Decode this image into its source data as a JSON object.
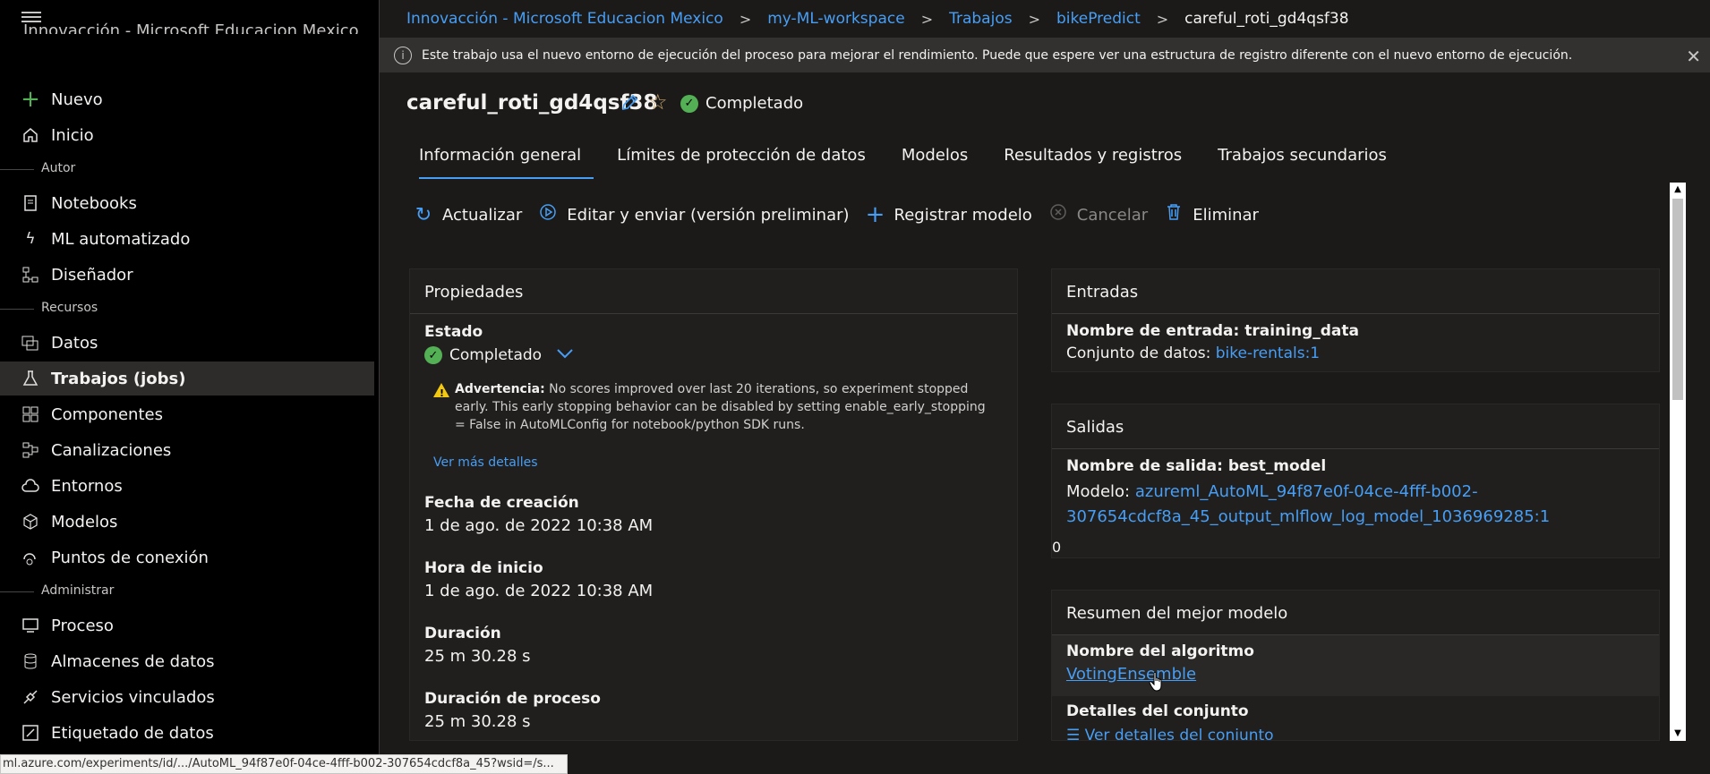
{
  "sidebar": {
    "workspace_name": "Innovacción - Microsoft Educacion Mexico",
    "new_label": "Nuevo",
    "home_label": "Inicio",
    "sections": {
      "author": "Autor",
      "assets": "Recursos",
      "manage": "Administrar"
    },
    "items": {
      "notebooks": "Notebooks",
      "automl": "ML automatizado",
      "designer": "Diseñador",
      "data": "Datos",
      "jobs": "Trabajos (jobs)",
      "components": "Componentes",
      "pipelines": "Canalizaciones",
      "environments": "Entornos",
      "models": "Modelos",
      "endpoints": "Puntos de conexión",
      "compute": "Proceso",
      "datastores": "Almacenes de datos",
      "linked": "Servicios vinculados",
      "labeling": "Etiquetado de datos"
    }
  },
  "breadcrumb": {
    "org": "Innovacción - Microsoft Educacion Mexico",
    "workspace": "my-ML-workspace",
    "jobs": "Trabajos",
    "experiment": "bikePredict",
    "current": "careful_roti_gd4qsf38"
  },
  "banner": {
    "text": "Este trabajo usa el nuevo entorno de ejecución del proceso para mejorar el rendimiento. Puede que espere ver una estructura de registro diferente con el nuevo entorno de ejecución."
  },
  "job": {
    "title": "careful_roti_gd4qsf38",
    "status": "Completado"
  },
  "tabs": [
    "Información general",
    "Límites de protección de datos",
    "Modelos",
    "Resultados y registros",
    "Trabajos secundarios"
  ],
  "toolbar": {
    "refresh": "Actualizar",
    "edit_submit": "Editar y enviar (versión preliminar)",
    "register_model": "Registrar modelo",
    "cancel": "Cancelar",
    "delete": "Eliminar"
  },
  "properties": {
    "header": "Propiedades",
    "state_label": "Estado",
    "state_value": "Completado",
    "warning_title": "Advertencia:",
    "warning_text": "No scores improved over last 20 iterations, so experiment stopped early. This early stopping behavior can be disabled by setting enable_early_stopping = False in AutoMLConfig for notebook/python SDK runs.",
    "see_more": "Ver más detalles",
    "created_label": "Fecha de creación",
    "created_value": "1 de ago. de 2022 10:38 AM",
    "start_label": "Hora de inicio",
    "start_value": "1 de ago. de 2022 10:38 AM",
    "duration_label": "Duración",
    "duration_value": "25 m 30.28 s",
    "compute_duration_label": "Duración de proceso",
    "compute_duration_value": "25 m 30.28 s"
  },
  "inputs": {
    "header": "Entradas",
    "name_label": "Nombre de entrada: training_data",
    "dataset_prefix": "Conjunto de datos:",
    "dataset_link": "bike-rentals:1"
  },
  "outputs": {
    "header": "Salidas",
    "name_label": "Nombre de salida: best_model",
    "model_prefix": "Modelo:",
    "model_link_line1": "azureml_AutoML_94f87e0f-04ce-4fff-b002-",
    "model_link_line2": "307654cdcf8a_45_output_mlflow_log_model_1036969285:1",
    "zero": "0"
  },
  "best_model": {
    "header": "Resumen del mejor modelo",
    "algorithm_label": "Nombre del algoritmo",
    "algorithm_value": "VotingEnsemble",
    "ensemble_label": "Detalles del conjunto",
    "ensemble_link": "Ver detalles del conjunto"
  },
  "status_bar": {
    "url": "ml.azure.com/experiments/id/.../AutoML_94f87e0f-04ce-4fff-b002-307654cdcf8a_45?wsid=/s..."
  },
  "colors": {
    "accent": "#479ef5",
    "success": "#54b054",
    "warning": "#f2c811"
  }
}
